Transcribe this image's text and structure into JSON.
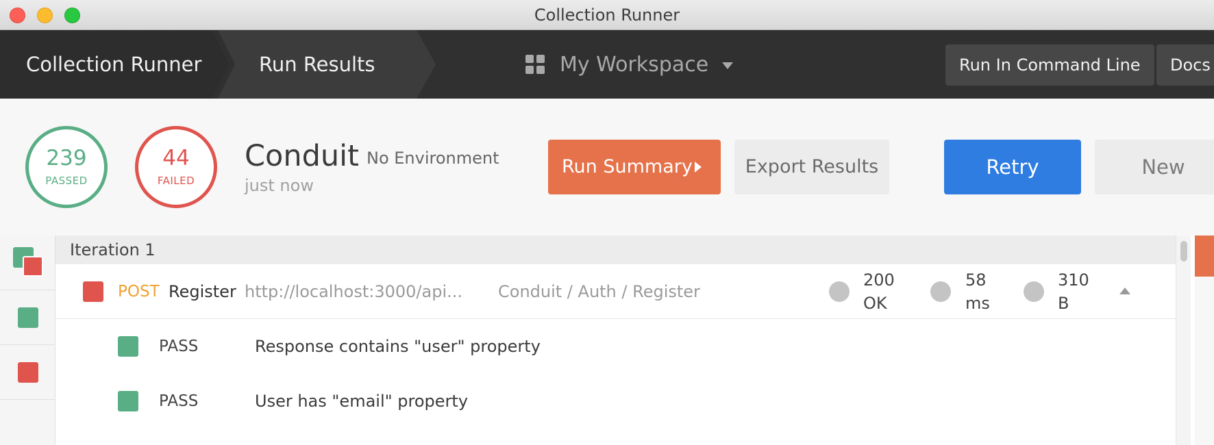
{
  "window": {
    "title": "Collection Runner"
  },
  "nav": {
    "crumb_runner": "Collection Runner",
    "crumb_results": "Run Results",
    "workspace": "My Workspace",
    "cmd_button": "Run In Command Line",
    "docs_button": "Docs"
  },
  "summary": {
    "passed_count": "239",
    "passed_label": "PASSED",
    "failed_count": "44",
    "failed_label": "FAILED",
    "collection_name": "Conduit",
    "environment": "No Environment",
    "time": "just now",
    "run_summary": "Run Summary",
    "export": "Export Results",
    "retry": "Retry",
    "new": "New"
  },
  "results": {
    "iteration_label": "Iteration 1",
    "request": {
      "method": "POST",
      "name": "Register",
      "url": "http://localhost:3000/api...",
      "path": "Conduit / Auth / Register",
      "status_code": "200",
      "status_text": "OK",
      "time_value": "58",
      "time_unit": "ms",
      "size_value": "310",
      "size_unit": "B"
    },
    "tests": [
      {
        "status": "PASS",
        "text": "Response contains \"user\" property"
      },
      {
        "status": "PASS",
        "text": "User has \"email\" property"
      }
    ]
  },
  "colors": {
    "pass": "#5aae86",
    "fail": "#e0544e",
    "primary": "#2f7de1",
    "accent": "#e5724a",
    "method_post": "#f0a030"
  }
}
